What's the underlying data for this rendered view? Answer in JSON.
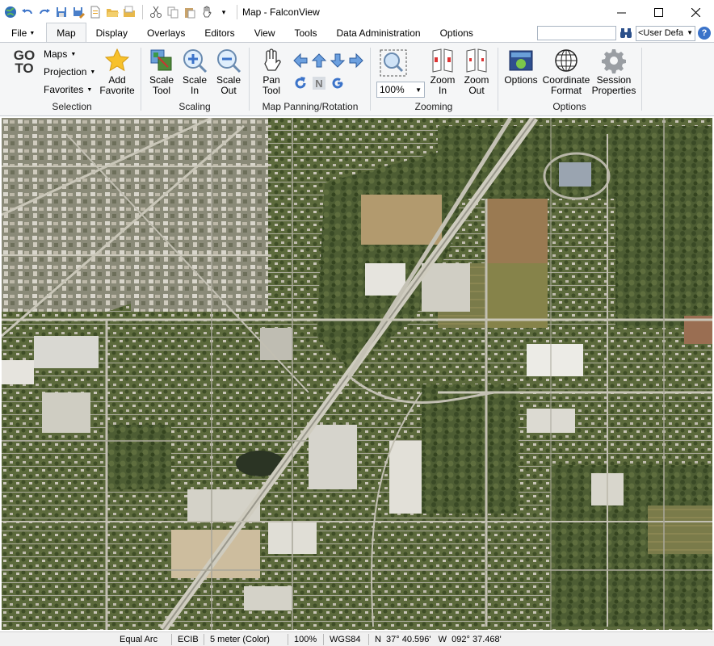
{
  "window": {
    "title": "Map - FalconView",
    "minimize_icon": "minimize-icon",
    "maximize_icon": "maximize-icon",
    "close_icon": "close-icon"
  },
  "quick_access": [
    "globe-icon",
    "undo-icon",
    "redo-icon",
    "save-icon",
    "save-as-icon",
    "new-icon",
    "open-folder-icon",
    "folder-icon",
    "cut-icon",
    "copy-icon",
    "paste-icon",
    "hand-icon",
    "dropdown-icon"
  ],
  "tabs": {
    "file": "File",
    "map": "Map",
    "display": "Display",
    "overlays": "Overlays",
    "editors": "Editors",
    "view": "View",
    "tools": "Tools",
    "data_administration": "Data Administration",
    "options": "Options"
  },
  "search": {
    "value": "",
    "combo_value": "<User Defa"
  },
  "ribbon": {
    "selection": {
      "label": "Selection",
      "goto_line1": "GO",
      "goto_line2": "TO",
      "maps": "Maps",
      "projection": "Projection",
      "favorites": "Favorites",
      "add_favorite_line1": "Add",
      "add_favorite_line2": "Favorite"
    },
    "scaling": {
      "label": "Scaling",
      "scale_tool_line1": "Scale",
      "scale_tool_line2": "Tool",
      "scale_in_line1": "Scale",
      "scale_in_line2": "In",
      "scale_out_line1": "Scale",
      "scale_out_line2": "Out"
    },
    "panning": {
      "label": "Map Panning/Rotation",
      "pan_tool_line1": "Pan",
      "pan_tool_line2": "Tool"
    },
    "zooming": {
      "label": "Zooming",
      "zoom_value": "100%",
      "zoom_in_line1": "Zoom",
      "zoom_in_line2": "In",
      "zoom_out_line1": "Zoom",
      "zoom_out_line2": "Out"
    },
    "options": {
      "label": "Options",
      "options_btn": "Options",
      "coordinate_format_line1": "Coordinate",
      "coordinate_format_line2": "Format",
      "session_properties_line1": "Session",
      "session_properties_line2": "Properties"
    }
  },
  "status": {
    "projection": "Equal Arc",
    "source": "ECIB",
    "resolution": "5 meter (Color)",
    "zoom": "100%",
    "datum": "WGS84",
    "coordinates": "N  37° 40.596'   W  092° 37.468'"
  },
  "colors": {
    "ribbon_bg": "#f5f6f7",
    "accent_blue": "#3b73c9",
    "map_base": "#5b6b3e"
  }
}
